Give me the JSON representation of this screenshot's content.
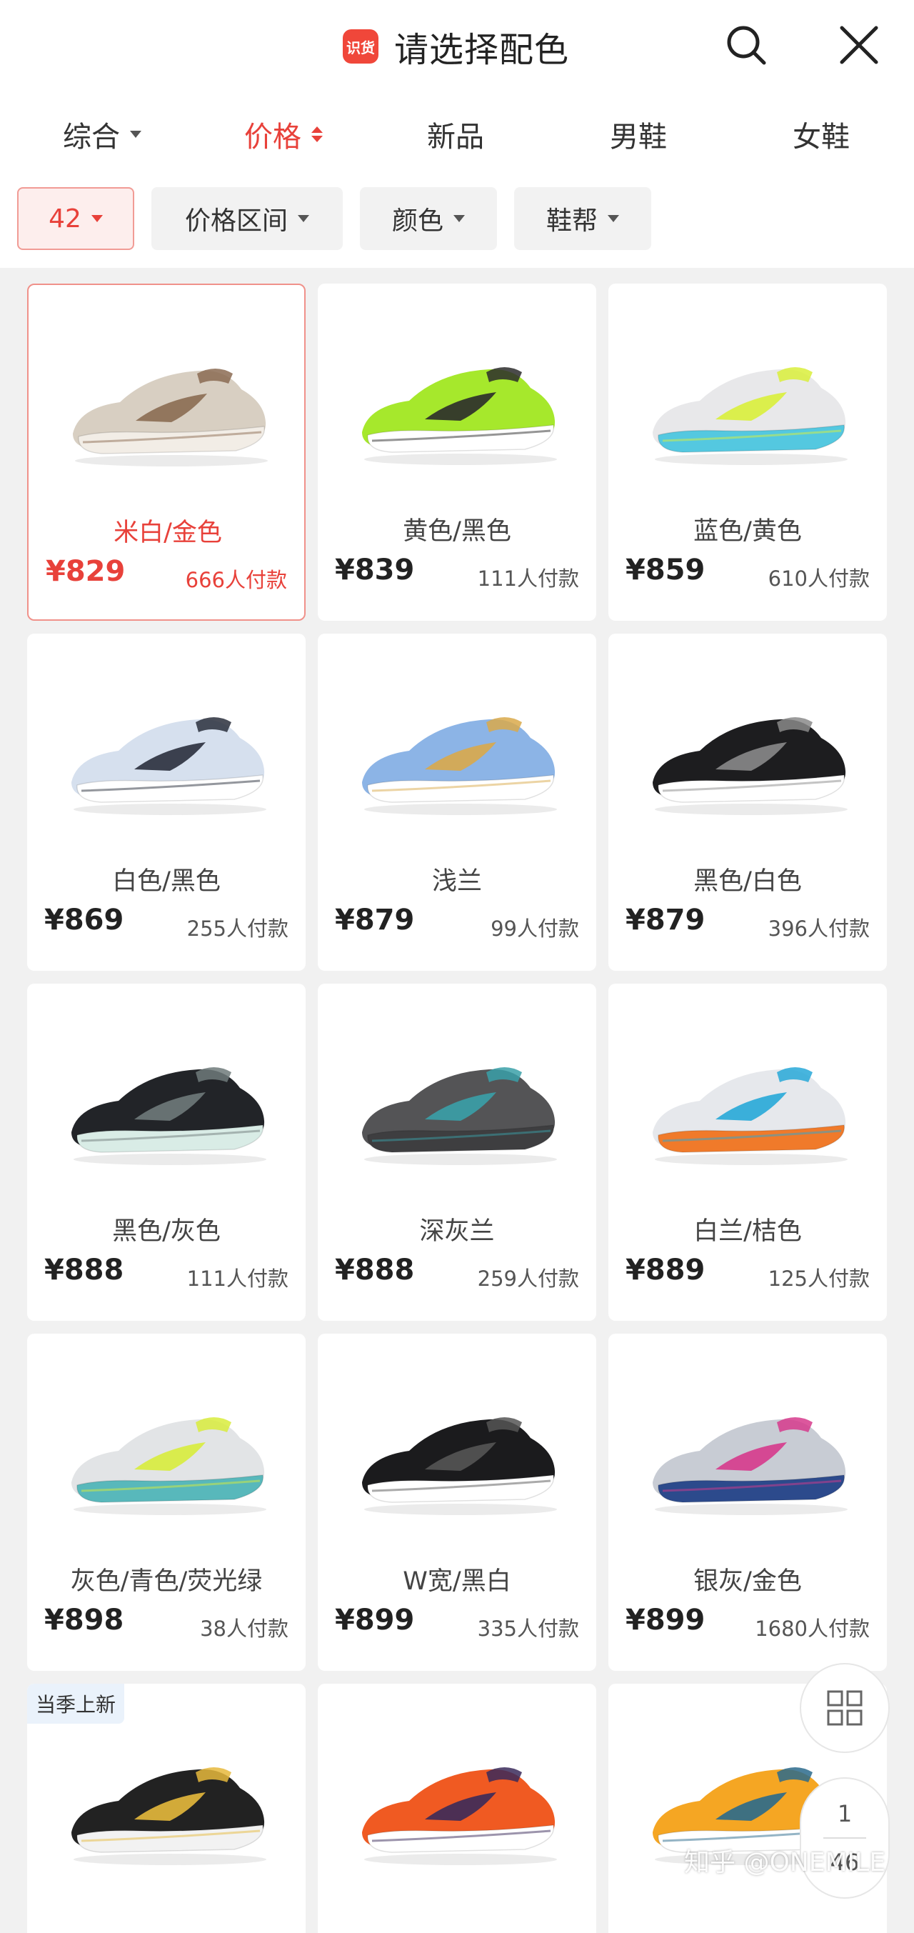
{
  "header": {
    "logo_text": "识货",
    "title": "请选择配色"
  },
  "sort_tabs": [
    {
      "label": "综合",
      "has_caret": true
    },
    {
      "label": "价格",
      "active": true,
      "sort_icon": true
    },
    {
      "label": "新品"
    },
    {
      "label": "男鞋"
    },
    {
      "label": "女鞋"
    }
  ],
  "filters": [
    {
      "label": "42",
      "active": true
    },
    {
      "label": "价格区间"
    },
    {
      "label": "颜色"
    },
    {
      "label": "鞋帮"
    }
  ],
  "products": [
    {
      "name": "米白/金色",
      "price": "¥829",
      "sold": "666人付款",
      "selected": true,
      "colors": [
        "#d8cfc2",
        "#8b6b52",
        "#f2ede6"
      ]
    },
    {
      "name": "黄色/黑色",
      "price": "¥839",
      "sold": "111人付款",
      "colors": [
        "#a6e82c",
        "#2b2b2b",
        "#ffffff"
      ]
    },
    {
      "name": "蓝色/黄色",
      "price": "¥859",
      "sold": "610人付款",
      "colors": [
        "#e8e8ea",
        "#d9ef3b",
        "#54c8e0"
      ]
    },
    {
      "name": "白色/黑色",
      "price": "¥869",
      "sold": "255人付款",
      "colors": [
        "#d6e0ee",
        "#2a2f3c",
        "#ffffff"
      ]
    },
    {
      "name": "浅兰",
      "price": "¥879",
      "sold": "99人付款",
      "colors": [
        "#8cb4e6",
        "#d9a94a",
        "#ffffff"
      ]
    },
    {
      "name": "黑色/白色",
      "price": "¥879",
      "sold": "396人付款",
      "colors": [
        "#1d1d1f",
        "#8a8a8a",
        "#ffffff"
      ]
    },
    {
      "name": "黑色/灰色",
      "price": "¥888",
      "sold": "111人付款",
      "colors": [
        "#222428",
        "#6f7a7a",
        "#d9ece6"
      ]
    },
    {
      "name": "深灰兰",
      "price": "¥888",
      "sold": "259人付款",
      "colors": [
        "#545456",
        "#3aa0a8",
        "#3e3e40"
      ]
    },
    {
      "name": "白兰/桔色",
      "price": "¥889",
      "sold": "125人付款",
      "colors": [
        "#e6e8ec",
        "#27a8d8",
        "#f07a2a"
      ]
    },
    {
      "name": "灰色/青色/荧光绿",
      "price": "¥898",
      "sold": "38人付款",
      "colors": [
        "#e2e4e6",
        "#d8ec3c",
        "#58b8bb"
      ]
    },
    {
      "name": "W宽/黑白",
      "price": "¥899",
      "sold": "335人付款",
      "colors": [
        "#1b1b1d",
        "#555555",
        "#ffffff"
      ]
    },
    {
      "name": "银灰/金色",
      "price": "¥899",
      "sold": "1680人付款",
      "colors": [
        "#c8ccd4",
        "#d63a8c",
        "#2c4a8c"
      ]
    },
    {
      "name": "",
      "price": "",
      "sold": "",
      "badge": "当季上新",
      "colors": [
        "#222222",
        "#e6b93c",
        "#f2f2f2"
      ]
    },
    {
      "name": "",
      "price": "",
      "sold": "",
      "colors": [
        "#f05a22",
        "#3a2a5a",
        "#ffffff"
      ]
    },
    {
      "name": "",
      "price": "",
      "sold": "",
      "colors": [
        "#f5a623",
        "#2a6a8c",
        "#ffffff"
      ]
    }
  ],
  "float": {
    "page_current": "1",
    "page_total": "46"
  },
  "watermark": "知乎 @ONEMILE",
  "accent_color": "#e8413a"
}
